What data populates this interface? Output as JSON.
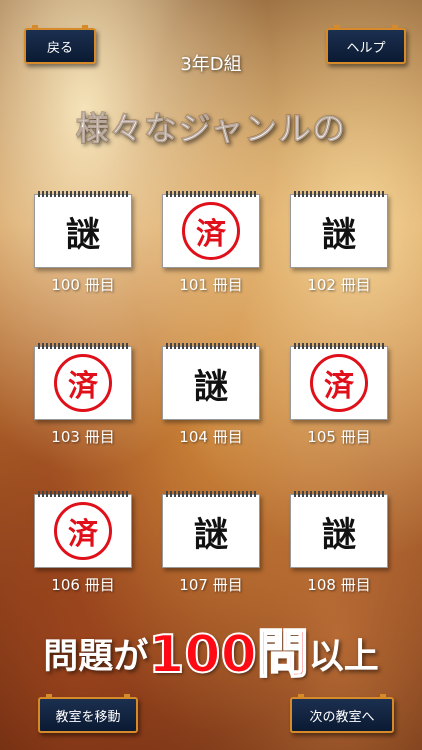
{
  "header": {
    "back_label": "戻る",
    "help_label": "ヘルプ",
    "class_title": "3年D組"
  },
  "headline": "様々なジャンルの",
  "books": [
    {
      "icon": "謎",
      "label": "100 冊目",
      "status": "unsolved"
    },
    {
      "icon": "済",
      "label": "101 冊目",
      "status": "completed"
    },
    {
      "icon": "謎",
      "label": "102 冊目",
      "status": "unsolved"
    },
    {
      "icon": "済",
      "label": "103 冊目",
      "status": "completed"
    },
    {
      "icon": "謎",
      "label": "104 冊目",
      "status": "unsolved"
    },
    {
      "icon": "済",
      "label": "105 冊目",
      "status": "completed"
    },
    {
      "icon": "済",
      "label": "106 冊目",
      "status": "completed"
    },
    {
      "icon": "謎",
      "label": "107 冊目",
      "status": "unsolved"
    },
    {
      "icon": "謎",
      "label": "108 冊目",
      "status": "unsolved"
    }
  ],
  "tagline": {
    "before": "問題が",
    "highlight": "100問",
    "after": "以上"
  },
  "footer": {
    "move_label": "教室を移動",
    "next_label": "次の教室へ"
  },
  "colors": {
    "stamp": "#e0101a",
    "button_bg": "#0b1a33",
    "button_border": "#d68a2a",
    "highlight": "#ff0a14"
  }
}
